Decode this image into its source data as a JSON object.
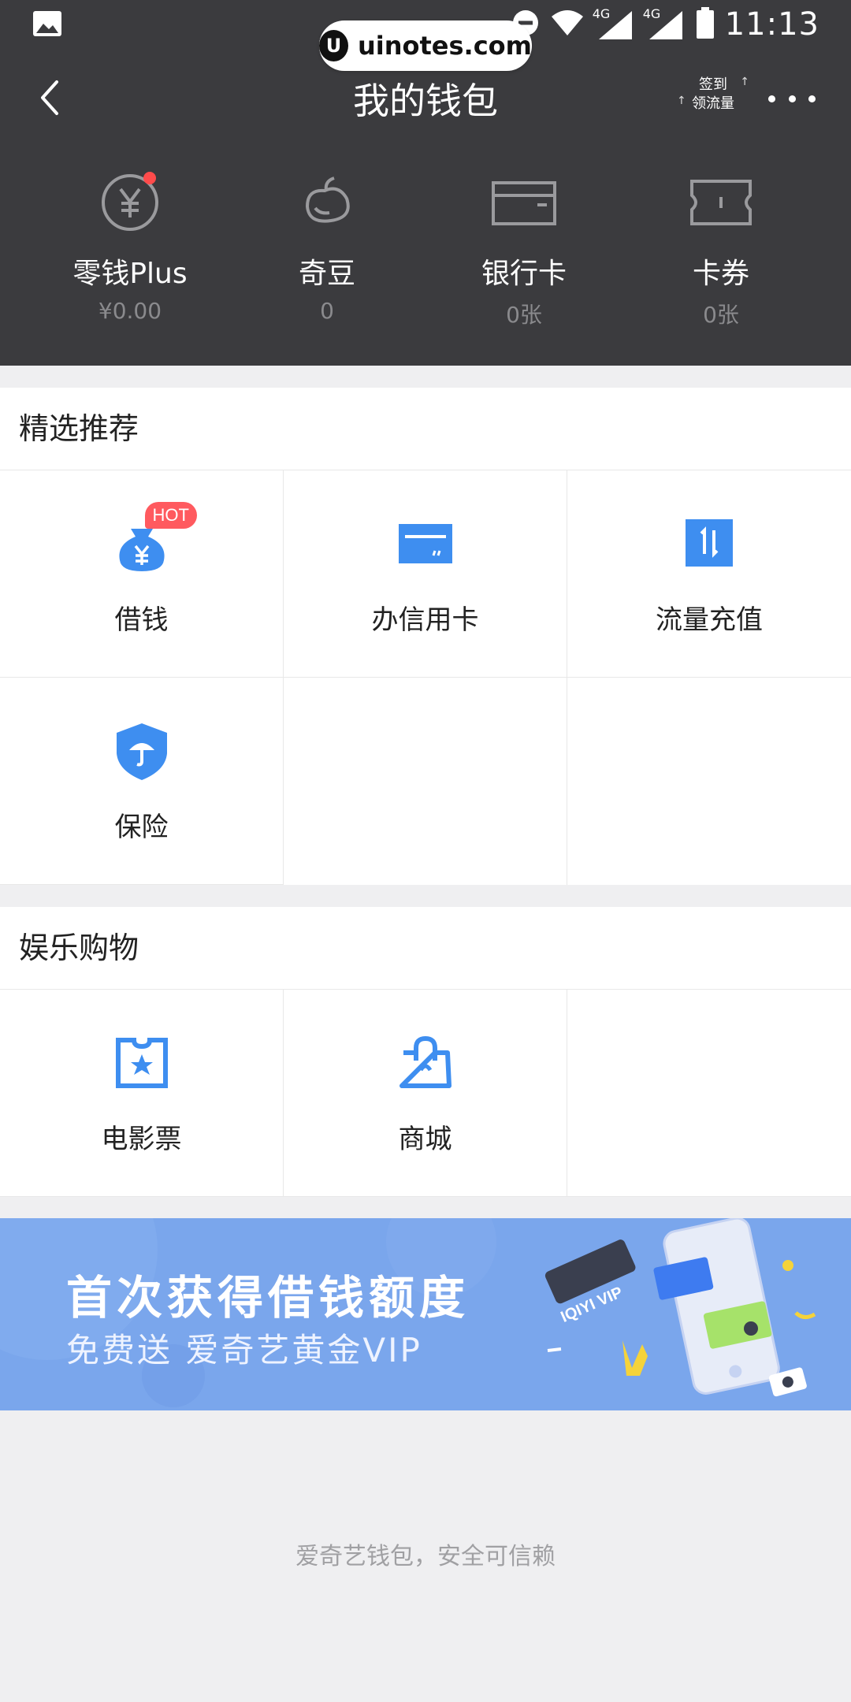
{
  "status_bar": {
    "time": "11:13",
    "network_left": "4G",
    "network_right": "4G"
  },
  "watermark": {
    "icon": "U",
    "text": "uinotes.com"
  },
  "header": {
    "title": "我的钱包",
    "signin_line1": "签到",
    "signin_line2": "领流量"
  },
  "assets": [
    {
      "icon": "yuan-coin-icon",
      "name": "零钱Plus",
      "value": "¥0.00",
      "has_dot": true
    },
    {
      "icon": "bean-icon",
      "name": "奇豆",
      "value": "0"
    },
    {
      "icon": "bank-card-icon",
      "name": "银行卡",
      "value": "0张"
    },
    {
      "icon": "coupon-icon",
      "name": "卡券",
      "value": "0张"
    }
  ],
  "featured": {
    "title": "精选推荐",
    "items": [
      {
        "label": "借钱",
        "icon": "money-bag-icon",
        "badge": "HOT"
      },
      {
        "label": "办信用卡",
        "icon": "credit-card-icon"
      },
      {
        "label": "流量充值",
        "icon": "data-topup-icon"
      },
      {
        "label": "保险",
        "icon": "insurance-shield-icon"
      }
    ]
  },
  "entertainment": {
    "title": "娱乐购物",
    "items": [
      {
        "label": "电影票",
        "icon": "movie-ticket-icon"
      },
      {
        "label": "商城",
        "icon": "shopping-bag-icon"
      }
    ]
  },
  "banner": {
    "line1": "首次获得借钱额度",
    "line2": "免费送 爱奇艺黄金VIP",
    "tag": "IQIYI VIP"
  },
  "footer": {
    "text": "爱奇艺钱包，安全可信赖"
  },
  "colors": {
    "header_bg": "#3b3b3e",
    "accent_blue": "#3e8ef0",
    "banner_bg": "#7aa6ec",
    "hot_badge": "#ff5a5f"
  }
}
